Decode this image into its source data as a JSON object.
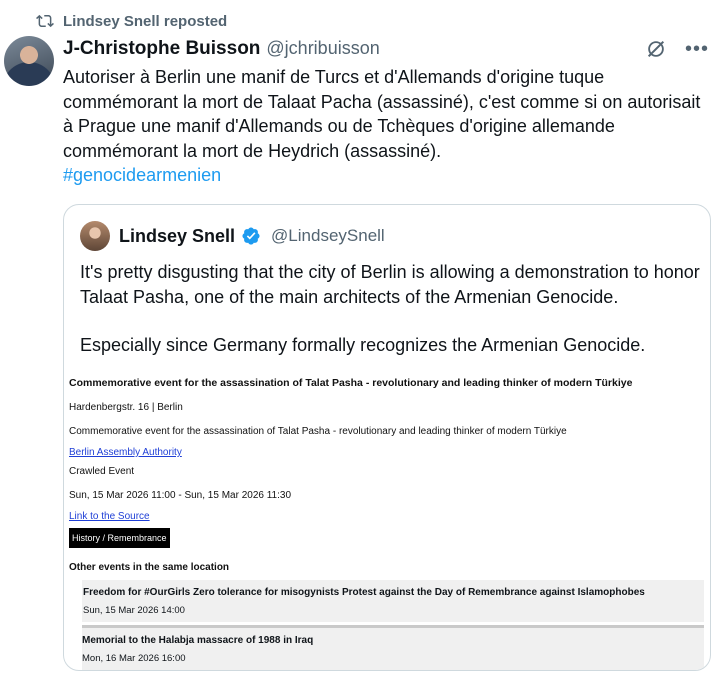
{
  "repost": {
    "text": "Lindsey Snell reposted",
    "icon": "repost-icon"
  },
  "tweet": {
    "author_name": "J-Christophe Buisson",
    "author_handle": "@jchribuisson",
    "text": "Autoriser à Berlin une manif de Turcs et d'Allemands d'origine tuque commémorant la mort de Talaat Pacha (assassiné), c'est comme si on autorisait à Prague une manif d'Allemands ou de Tchèques d'origine allemande commémorant la mort de Heydrich (assassiné).",
    "hashtag": "#genocidearmenien"
  },
  "quote": {
    "author_name": "Lindsey Snell",
    "author_handle": "@LindseySnell",
    "paragraph_1": "It's pretty disgusting that the city of Berlin is allowing a demonstration to honor Talaat Pasha, one of the main architects of the Armenian Genocide.",
    "paragraph_2": "Especially since Germany formally recognizes the Armenian Genocide."
  },
  "event": {
    "title": "Commemorative event for the assassination of Talat Pasha - revolutionary and leading thinker of modern Türkiye",
    "address": "Hardenbergstr. 16 | Berlin",
    "description": "Commemorative event for the assassination of Talat Pasha - revolutionary and leading thinker of modern Türkiye",
    "authority_link": "Berlin Assembly Authority",
    "crawled": "Crawled Event",
    "datetime": "Sun, 15 Mar 2026 11:00 - Sun, 15 Mar 2026 11:30",
    "source_link": "Link to the Source",
    "tag": "History / Remembrance",
    "other_heading": "Other events in the same location",
    "other_events": [
      {
        "title": "Freedom for #OurGirls Zero tolerance for misogynists Protest against the Day of Remembrance against Islamophobes",
        "date": "Sun, 15 Mar 2026 14:00"
      },
      {
        "title": "Memorial to the Halabja massacre of 1988 in Iraq",
        "date": "Mon, 16 Mar 2026 16:00"
      }
    ]
  },
  "colors": {
    "accent": "#1d9bf0",
    "secondary_text": "#536471",
    "border": "#cfd9de",
    "link_blue": "#1f3fd6"
  }
}
